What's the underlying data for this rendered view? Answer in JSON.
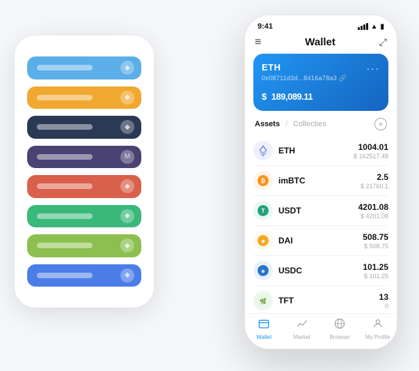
{
  "scene": {
    "bg_color": "#f5f7fa"
  },
  "left_phone": {
    "cards": [
      {
        "color": "#5baee8",
        "label": "",
        "icon": "◆"
      },
      {
        "color": "#f0a830",
        "label": "",
        "icon": "◆"
      },
      {
        "color": "#2b3a54",
        "label": "",
        "icon": "◆"
      },
      {
        "color": "#4a4272",
        "label": "",
        "icon": "M"
      },
      {
        "color": "#d9604a",
        "label": "",
        "icon": "◆"
      },
      {
        "color": "#3ab87a",
        "label": "",
        "icon": "◆"
      },
      {
        "color": "#8cbf4f",
        "label": "",
        "icon": "◆"
      },
      {
        "color": "#4a7de8",
        "label": "",
        "icon": "◆"
      }
    ]
  },
  "right_phone": {
    "status_bar": {
      "time": "9:41",
      "signal": "●●●●",
      "wifi": "▲",
      "battery": "▮"
    },
    "header": {
      "menu_icon": "≡",
      "title": "Wallet",
      "expand_icon": "⤢"
    },
    "eth_card": {
      "title": "ETH",
      "address": "0x08711d3d...8416a78a3 🔗",
      "dots": "...",
      "balance_prefix": "$",
      "balance": "189,089.11"
    },
    "assets_header": {
      "active_tab": "Assets",
      "divider": "/",
      "inactive_tab": "Collecties",
      "add_label": "+"
    },
    "assets": [
      {
        "name": "ETH",
        "icon": "♦",
        "icon_color": "#627eea",
        "icon_bg": "#eef0fb",
        "amount": "1004.01",
        "usd": "$ 162517.48"
      },
      {
        "name": "imBTC",
        "icon": "●",
        "icon_color": "#f7931a",
        "icon_bg": "#fff4e6",
        "amount": "2.5",
        "usd": "$ 21760.1"
      },
      {
        "name": "USDT",
        "icon": "T",
        "icon_color": "#26a17b",
        "icon_bg": "#e8f8f4",
        "amount": "4201.08",
        "usd": "$ 4201.08"
      },
      {
        "name": "DAI",
        "icon": "◉",
        "icon_color": "#f5a623",
        "icon_bg": "#fff8ec",
        "amount": "508.75",
        "usd": "$ 508.75"
      },
      {
        "name": "USDC",
        "icon": "⊕",
        "icon_color": "#2775ca",
        "icon_bg": "#eaf1fb",
        "amount": "101.25",
        "usd": "$ 101.25"
      },
      {
        "name": "TFT",
        "icon": "🌿",
        "icon_color": "#4caf50",
        "icon_bg": "#eaf7eb",
        "amount": "13",
        "usd": "0"
      }
    ],
    "nav": [
      {
        "label": "Wallet",
        "icon": "◎",
        "active": true
      },
      {
        "label": "Market",
        "icon": "📊",
        "active": false
      },
      {
        "label": "Browser",
        "icon": "⊙",
        "active": false
      },
      {
        "label": "My Profile",
        "icon": "👤",
        "active": false
      }
    ]
  }
}
